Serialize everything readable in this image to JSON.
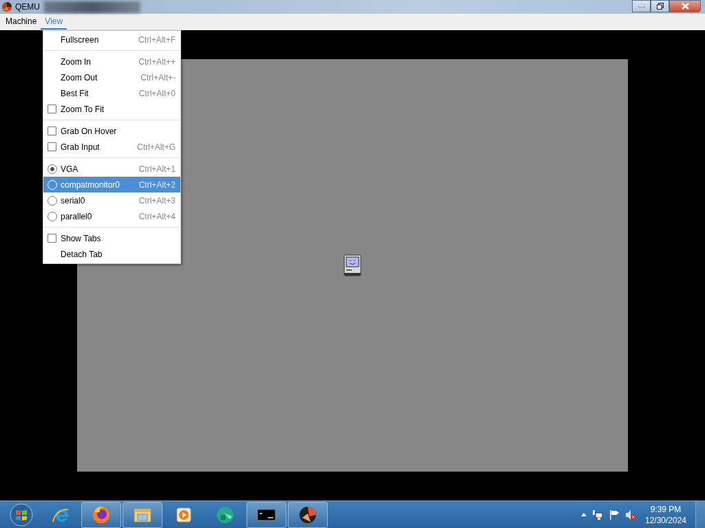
{
  "window": {
    "title": "QEMU"
  },
  "menubar": [
    {
      "label": "Machine",
      "selected": false
    },
    {
      "label": "View",
      "selected": true
    }
  ],
  "view_menu": [
    {
      "kind": "action",
      "label": "Fullscreen",
      "shortcut": "Ctrl+Alt+F",
      "highlighted": false
    },
    {
      "kind": "separator"
    },
    {
      "kind": "action",
      "label": "Zoom In",
      "shortcut": "Ctrl+Alt++",
      "highlighted": false
    },
    {
      "kind": "action",
      "label": "Zoom Out",
      "shortcut": "Ctrl+Alt+-",
      "highlighted": false
    },
    {
      "kind": "action",
      "label": "Best Fit",
      "shortcut": "Ctrl+Alt+0",
      "highlighted": false
    },
    {
      "kind": "check",
      "label": "Zoom To Fit",
      "checked": false,
      "highlighted": false
    },
    {
      "kind": "separator"
    },
    {
      "kind": "check",
      "label": "Grab On Hover",
      "checked": false,
      "highlighted": false
    },
    {
      "kind": "check",
      "label": "Grab Input",
      "shortcut": "Ctrl+Alt+G",
      "checked": false,
      "highlighted": false
    },
    {
      "kind": "separator"
    },
    {
      "kind": "radio",
      "label": "VGA",
      "shortcut": "Ctrl+Alt+1",
      "selected": true,
      "highlighted": false
    },
    {
      "kind": "radio",
      "label": "compatmonitor0",
      "shortcut": "Ctrl+Alt+2",
      "selected": false,
      "highlighted": true
    },
    {
      "kind": "radio",
      "label": "serial0",
      "shortcut": "Ctrl+Alt+3",
      "selected": false,
      "highlighted": false
    },
    {
      "kind": "radio",
      "label": "parallel0",
      "shortcut": "Ctrl+Alt+4",
      "selected": false,
      "highlighted": false
    },
    {
      "kind": "separator"
    },
    {
      "kind": "check",
      "label": "Show Tabs",
      "checked": false,
      "highlighted": false
    },
    {
      "kind": "action",
      "label": "Detach Tab",
      "highlighted": false
    }
  ],
  "taskbar": {
    "apps": [
      {
        "kind": "ie",
        "running": false
      },
      {
        "kind": "firefox",
        "running": true
      },
      {
        "kind": "explorer",
        "running": true
      },
      {
        "kind": "media",
        "running": false
      },
      {
        "kind": "globe",
        "running": false
      },
      {
        "kind": "cmd",
        "running": true
      },
      {
        "kind": "qemu",
        "running": true
      }
    ],
    "clock": {
      "time": "9:39 PM",
      "date": "12/30/2024"
    }
  }
}
